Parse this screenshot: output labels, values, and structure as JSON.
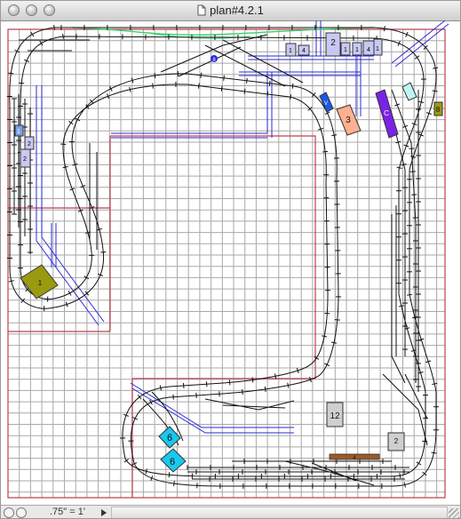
{
  "window": {
    "title": "plan#4.2.1"
  },
  "status": {
    "scale": ".75\" = 1'"
  },
  "colors": {
    "grid": "#a9a9a9",
    "track": "#111111",
    "wire_blue": "#2a2ad8",
    "boundary_red": "#c04050",
    "green_track": "#35d46a",
    "olive": "#9a9a10",
    "cyan": "#18c8ee",
    "purple": "#7a22e6",
    "salmon": "#ffb090",
    "brown": "#9a5a28",
    "lavender": "#c8c8f2",
    "gray_bldg": "#cfcfcf"
  },
  "buildings": [
    {
      "label": "1"
    },
    {
      "label": "2"
    },
    {
      "label": "3"
    },
    {
      "label": "C"
    },
    {
      "label": "6"
    },
    {
      "label": "6"
    },
    {
      "label": "12"
    },
    {
      "label": "2"
    },
    {
      "label": "4"
    },
    {
      "label": "8"
    },
    {
      "label": "V"
    },
    {
      "label": "8"
    }
  ],
  "signals": [
    {
      "label": "1"
    },
    {
      "label": "4"
    },
    {
      "label": "1"
    },
    {
      "label": "1"
    },
    {
      "label": "4"
    },
    {
      "label": "1"
    },
    {
      "label": "1"
    },
    {
      "label": "2"
    },
    {
      "label": "2"
    }
  ]
}
